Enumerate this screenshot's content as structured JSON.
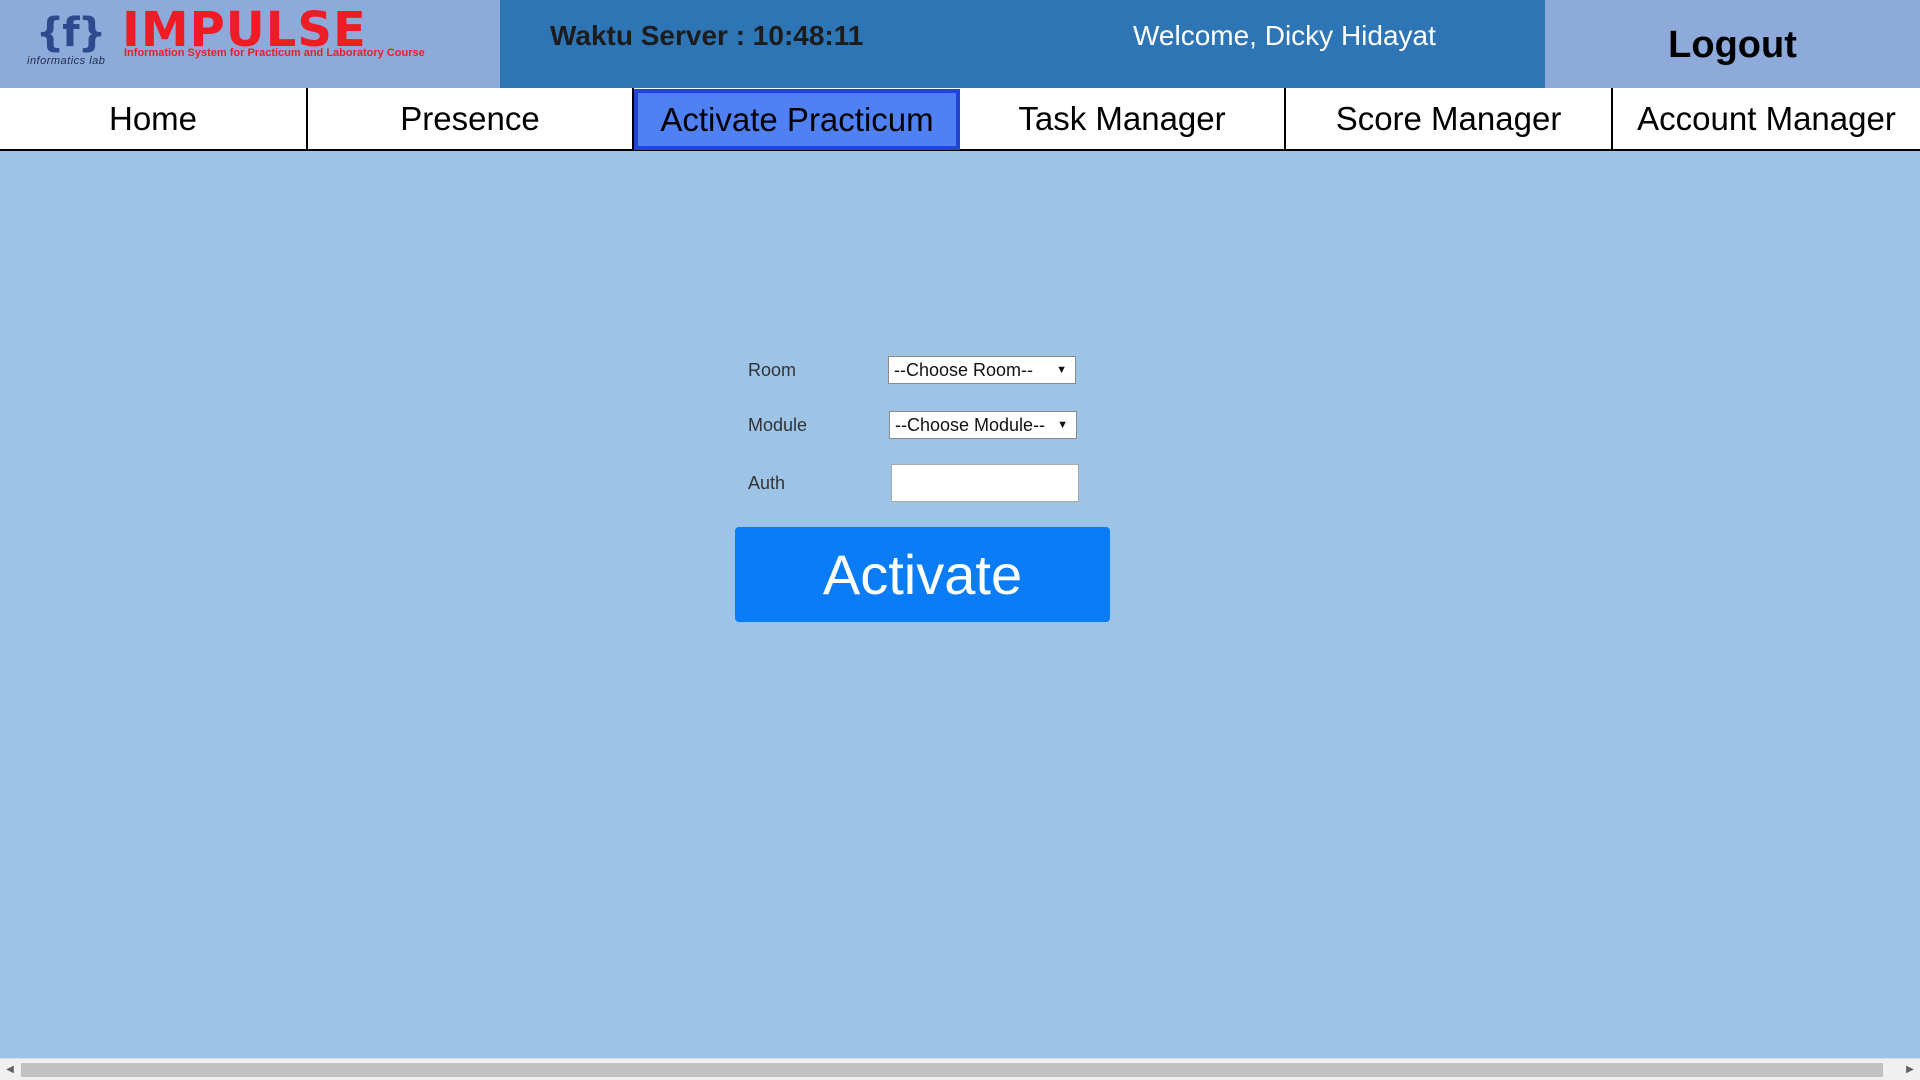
{
  "brand": {
    "title": "IMPULSE",
    "tagline": "Information System for Practicum and Laboratory Course",
    "sub": "informatics lab",
    "logo_icon": "if-logo-icon"
  },
  "header": {
    "server_time": "Waktu Server : 10:48:11",
    "welcome": "Welcome, Dicky Hidayat",
    "logout_label": "Logout"
  },
  "nav": {
    "items": [
      {
        "label": "Home"
      },
      {
        "label": "Presence"
      },
      {
        "label": "Activate Practicum",
        "active": true
      },
      {
        "label": "Task Manager"
      },
      {
        "label": "Score Manager"
      },
      {
        "label": "Account Manager"
      }
    ]
  },
  "form": {
    "room_label": "Room",
    "room_value": "--Choose Room--",
    "module_label": "Module",
    "module_value": "--Choose Module--",
    "auth_label": "Auth",
    "auth_value": "",
    "activate_label": "Activate"
  },
  "colors": {
    "page_bg": "#9dc3e6",
    "brand_bg": "#8eaadb",
    "server_bar_bg": "#2e75b6",
    "logo_red": "#ee1c25",
    "active_tab_bg": "#4f81f5",
    "activate_button": "#0a7cf5"
  }
}
